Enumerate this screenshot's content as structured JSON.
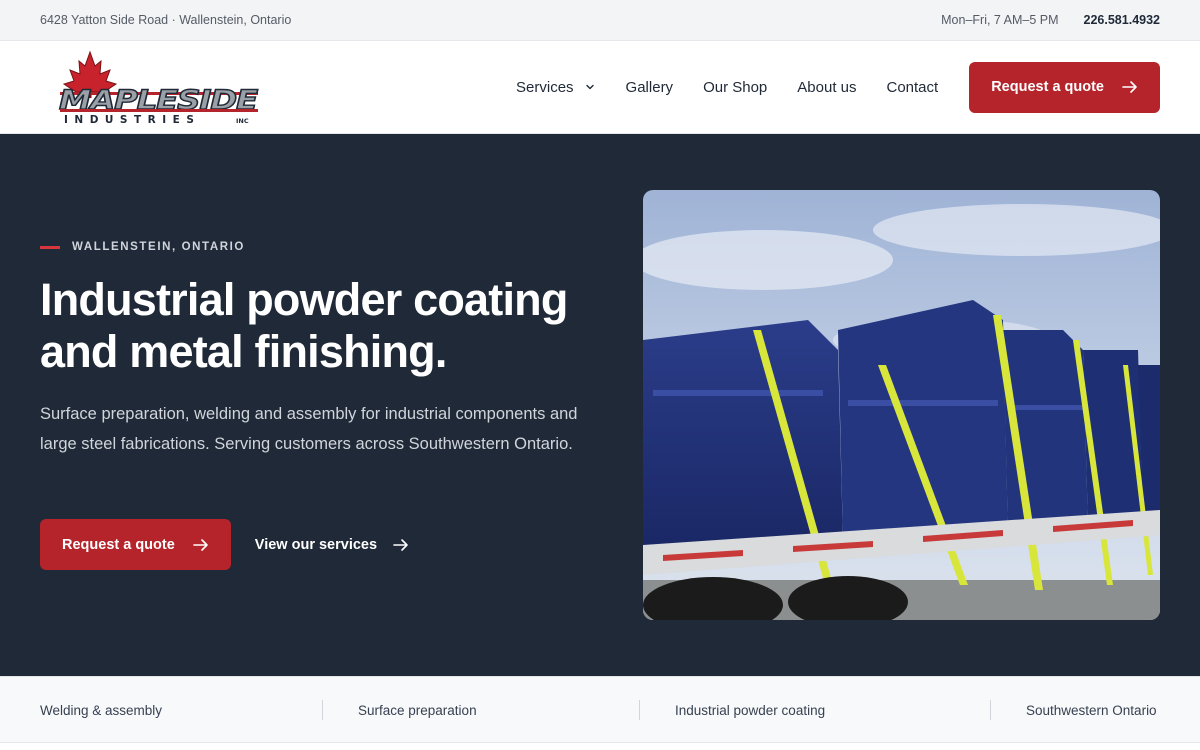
{
  "topbar": {
    "address": "6428 Yatton Side Road · Wallenstein, Ontario",
    "hours": "Mon–Fri, 7 AM–5 PM",
    "phone": "226.581.4932"
  },
  "header": {
    "logo": {
      "wordmark": "MAPLESIDE",
      "sub": "INDUSTRIES",
      "suffix": "INC"
    },
    "nav": [
      {
        "label": "Services"
      },
      {
        "label": "Gallery"
      },
      {
        "label": "Our Shop"
      },
      {
        "label": "About us"
      },
      {
        "label": "Contact"
      }
    ],
    "cta_label": "Request a quote"
  },
  "hero": {
    "eyebrow": "WALLENSTEIN, ONTARIO",
    "title_line1": "Industrial powder coating",
    "title_line2": "and metal finishing.",
    "text": "Surface preparation, welding and assembly for industrial components and large steel fabrications. Serving customers across Southwestern Ontario.",
    "primary_label": "Request a quote",
    "secondary_label": "View our services",
    "image_icon": "truck-with-blue-containers-photo"
  },
  "strip": {
    "items": [
      "Welding & assembly",
      "Surface preparation",
      "Industrial powder coating",
      "Southwestern Ontario"
    ]
  },
  "colors": {
    "accent": "#b5242b",
    "hero_bg": "#1f2937",
    "eyebrow_line": "#d7363c"
  },
  "icons": {
    "dropdown": "chevron-down-icon",
    "arrow": "arrow-right-icon",
    "logo_leaf": "maple-leaf-icon"
  }
}
